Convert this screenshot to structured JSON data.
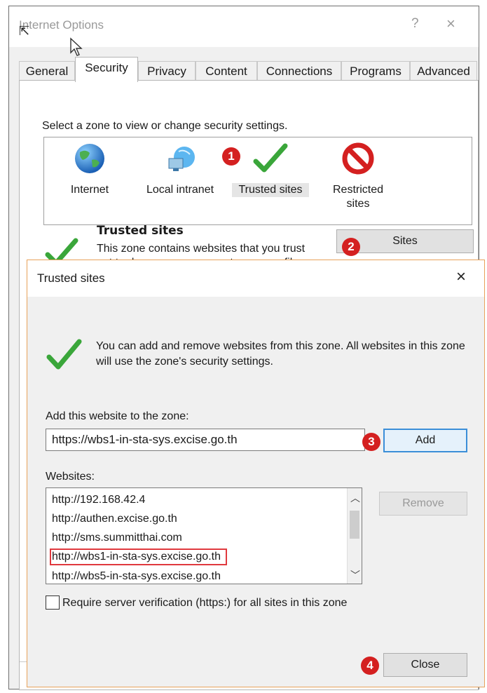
{
  "internet_options": {
    "title": "Internet Options",
    "help_glyph": "?",
    "close_glyph": "×",
    "tabs": [
      {
        "label": "General",
        "active": false
      },
      {
        "label": "Security",
        "active": true
      },
      {
        "label": "Privacy",
        "active": false
      },
      {
        "label": "Content",
        "active": false
      },
      {
        "label": "Connections",
        "active": false
      },
      {
        "label": "Programs",
        "active": false
      },
      {
        "label": "Advanced",
        "active": false
      }
    ],
    "zone_instruction": "Select a zone to view or change security settings.",
    "zones": [
      {
        "label": "Internet",
        "icon": "globe-icon"
      },
      {
        "label": "Local intranet",
        "icon": "intranet-icon"
      },
      {
        "label": "Trusted sites",
        "icon": "checkmark-icon",
        "selected": true
      },
      {
        "label": "Restricted sites",
        "icon": "restricted-icon"
      }
    ],
    "section_title": "Trusted sites",
    "section_description": "This zone contains websites that you trust not to damage your computer or your files.",
    "sites_button": "Sites"
  },
  "trusted_sites_dialog": {
    "title": "Trusted sites",
    "close_glyph": "×",
    "info_text": "You can add and remove websites from this zone. All websites in this zone will use the zone's security settings.",
    "add_label": "Add this website to the zone:",
    "url_value": "https://wbs1-in-sta-sys.excise.go.th",
    "add_button": "Add",
    "websites_label": "Websites:",
    "websites": [
      "http://192.168.42.4",
      "http://authen.excise.go.th",
      "http://sms.summitthai.com",
      "http://wbs1-in-sta-sys.excise.go.th",
      "http://wbs5-in-sta-sys.excise.go.th"
    ],
    "highlighted_index": 3,
    "remove_button": "Remove",
    "require_verification_label": "Require server verification (https:) for all sites in this zone",
    "require_verification_checked": false,
    "close_button": "Close"
  },
  "markers": [
    "1",
    "2",
    "3",
    "4"
  ],
  "colors": {
    "marker_red": "#d42020",
    "highlight_red": "#e0393e",
    "dialog_border": "#e8a25a",
    "check_green": "#3aa63a"
  }
}
